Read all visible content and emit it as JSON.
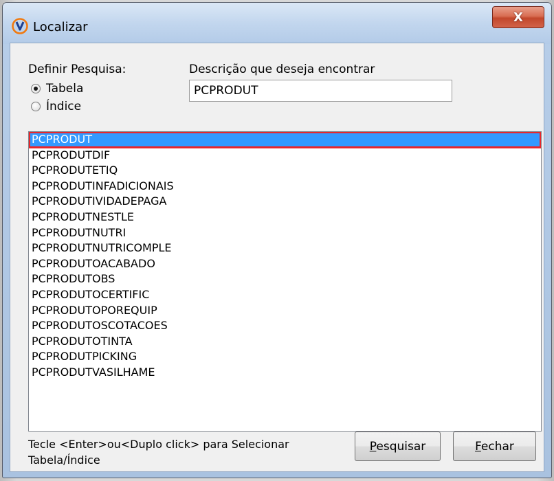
{
  "window": {
    "title": "Localizar",
    "close_label": "X"
  },
  "search": {
    "define_label": "Definir Pesquisa:",
    "description_label": "Descrição que deseja encontrar",
    "value": "PCPRODUT",
    "options": [
      {
        "label": "Tabela",
        "checked": true
      },
      {
        "label": "Índice",
        "checked": false
      }
    ]
  },
  "results": {
    "selected_index": 0,
    "items": [
      "PCPRODUT",
      "PCPRODUTDIF",
      "PCPRODUTETIQ",
      "PCPRODUTINFADICIONAIS",
      "PCPRODUTIVIDADEPAGA",
      "PCPRODUTNESTLE",
      "PCPRODUTNUTRI",
      "PCPRODUTNUTRICOMPLE",
      "PCPRODUTOACABADO",
      "PCPRODUTOBS",
      "PCPRODUTOCERTIFIC",
      "PCPRODUTOPOREQUIP",
      "PCPRODUTOSCOTACOES",
      "PCPRODUTOTINTA",
      "PCPRODUTPICKING",
      "PCPRODUTVASILHAME"
    ]
  },
  "footer": {
    "hint_line1": "Tecle <Enter>ou<Duplo click> para Selecionar",
    "hint_line2": "Tabela/Índice",
    "search_button_first": "P",
    "search_button_rest": "esquisar",
    "close_button_first": "F",
    "close_button_rest": "echar"
  },
  "colors": {
    "selection": "#3399ff",
    "highlight_border": "#e8262b",
    "close_button": "#c2472b"
  }
}
